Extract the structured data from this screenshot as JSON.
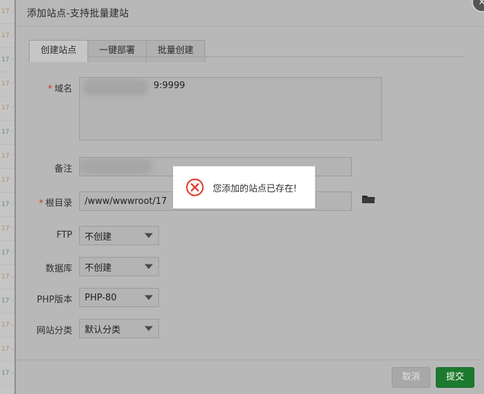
{
  "background": {
    "rows": [
      "17 ·",
      "17 ·",
      "17 ·",
      "17 ·",
      "17 ·",
      "17 ·",
      "17 ·",
      "17 ·",
      "17 ·",
      "17 ·",
      "17 ·",
      "17 ·",
      "17 ·",
      "17 ·",
      "17 ·",
      "17 ·"
    ]
  },
  "modal": {
    "title": "添加站点-支持批量建站",
    "close_icon": "close-icon",
    "close_label": "×"
  },
  "tabs": [
    {
      "label": "创建站点",
      "active": true
    },
    {
      "label": "一键部署",
      "active": false
    },
    {
      "label": "批量创建",
      "active": false
    }
  ],
  "form": {
    "domain": {
      "label": "域名",
      "required": true,
      "required_mark": "*",
      "value": "9:9999",
      "redacted": true
    },
    "remark": {
      "label": "备注",
      "required": false,
      "value": "",
      "redacted": true
    },
    "root_dir": {
      "label": "根目录",
      "required": true,
      "required_mark": "*",
      "value": "/www/wwwroot/17",
      "browse_icon": "folder-icon"
    },
    "ftp": {
      "label": "FTP",
      "value": "不创建",
      "caret_icon": "chevron-down-icon"
    },
    "database": {
      "label": "数据库",
      "value": "不创建",
      "caret_icon": "chevron-down-icon"
    },
    "php_version": {
      "label": "PHP版本",
      "value": "PHP-80",
      "caret_icon": "chevron-down-icon"
    },
    "site_category": {
      "label": "网站分类",
      "value": "默认分类",
      "caret_icon": "chevron-down-icon"
    }
  },
  "toast": {
    "message": "您添加的站点已存在!",
    "icon": "error-circle-x-icon",
    "icon_color": "#e0392b"
  },
  "footer": {
    "cancel_label": "取消",
    "submit_label": "提交",
    "submit_color": "#1b7a2d"
  }
}
